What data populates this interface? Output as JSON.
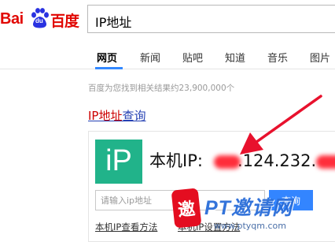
{
  "logo": {
    "latin": "Bai",
    "du": "du",
    "chinese": "百度"
  },
  "search": {
    "query": "IP地址"
  },
  "tabs": [
    {
      "label": "网页",
      "active": true
    },
    {
      "label": "新闻",
      "active": false
    },
    {
      "label": "贴吧",
      "active": false
    },
    {
      "label": "知道",
      "active": false
    },
    {
      "label": "音乐",
      "active": false
    },
    {
      "label": "图片",
      "active": false
    }
  ],
  "results": {
    "count_text": "百度为您找到相关结果约23,900,000个",
    "title_highlight": "IP地址",
    "title_rest": "查询"
  },
  "ip_card": {
    "logo_text": "iP",
    "label": "本机IP:",
    "ip_middle": ".124.232.",
    "input_placeholder": "请输入ip地址",
    "query_button": "查询",
    "link_left": "本机IP查看方法",
    "link_right": "本机IP设置方法"
  },
  "watermark": {
    "badge": "邀",
    "text": "PT邀请网",
    "url": "www.ptyqm.com"
  },
  "colors": {
    "brand_red": "#e10601",
    "brand_blue": "#2932e1",
    "link_blue": "#2440b3",
    "accent_blue": "#3385ff",
    "ip_green": "#21b38a",
    "redaction_red": "#ff2d3a",
    "arrow": "#e8112d"
  }
}
